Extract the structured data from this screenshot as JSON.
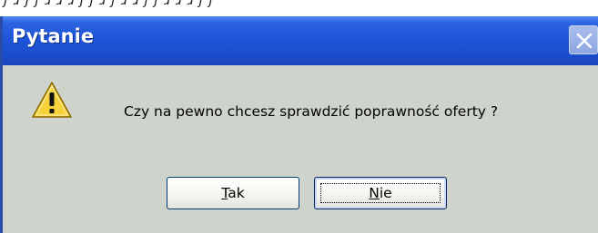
{
  "dialog": {
    "title": "Pytanie",
    "message": "Czy na pewno chcesz sprawdzić poprawność oferty ?",
    "buttons": {
      "yes": {
        "mnemonic": "T",
        "rest": "ak"
      },
      "no": {
        "mnemonic": "N",
        "rest": "ie"
      }
    },
    "icons": {
      "close": "close-icon",
      "status": "warning-icon"
    }
  },
  "colors": {
    "titlebar": "#1f55d9",
    "dialog_background": "#ced4cc",
    "title_text": "#ffffff"
  }
}
